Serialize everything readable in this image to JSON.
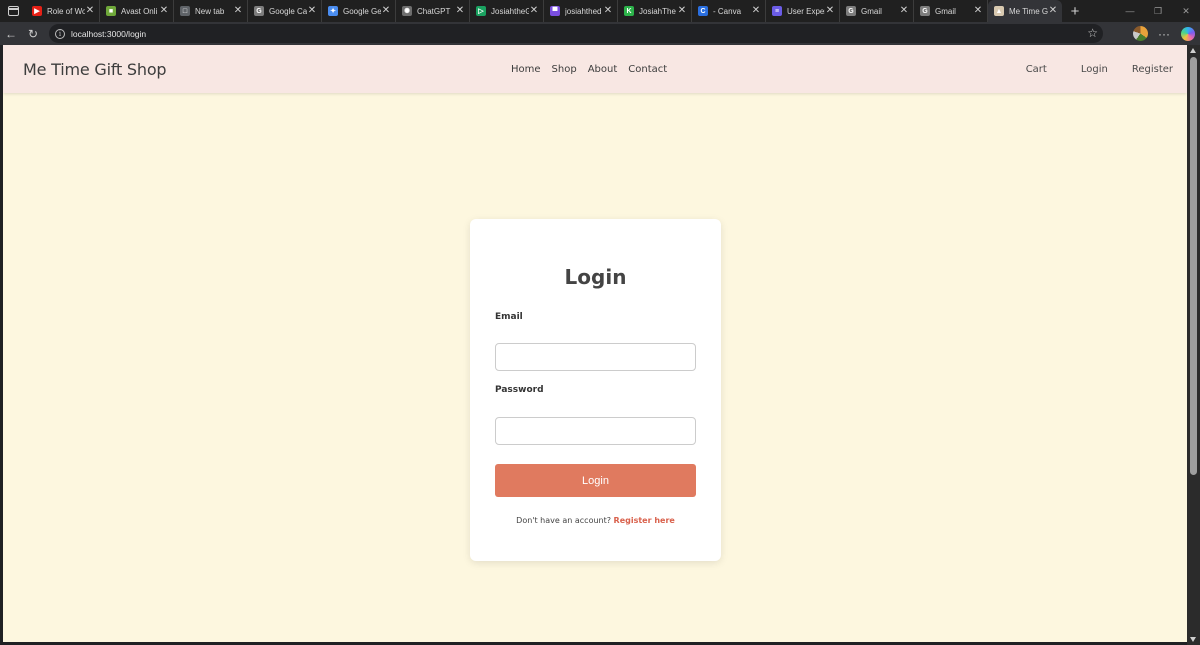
{
  "browser": {
    "tabs": [
      {
        "title": "Role of Wo",
        "fav_color": "#e62117",
        "fav_glyph": "▶",
        "active": false
      },
      {
        "title": "Avast Onli",
        "fav_color": "#6fa83a",
        "fav_glyph": "■",
        "active": false
      },
      {
        "title": "New tab",
        "fav_color": "#5f6368",
        "fav_glyph": "□",
        "active": false
      },
      {
        "title": "Google Ca",
        "fav_color": "#7d7d7d",
        "fav_glyph": "G",
        "active": false
      },
      {
        "title": "Google Ge",
        "fav_color": "#4a8df0",
        "fav_glyph": "✦",
        "active": false
      },
      {
        "title": "ChatGPT",
        "fav_color": "#6e6e6e",
        "fav_glyph": "✺",
        "active": false
      },
      {
        "title": "JosiahtheG",
        "fav_color": "#1aa260",
        "fav_glyph": "▷",
        "active": false
      },
      {
        "title": "josiahthed",
        "fav_color": "#7a4ee0",
        "fav_glyph": "▀",
        "active": false
      },
      {
        "title": "JosiahThe",
        "fav_color": "#2cb34a",
        "fav_glyph": "K",
        "active": false
      },
      {
        "title": "- Canva",
        "fav_color": "#2a6fe0",
        "fav_glyph": "C",
        "active": false
      },
      {
        "title": "User Exper",
        "fav_color": "#6b5ce6",
        "fav_glyph": "≡",
        "active": false
      },
      {
        "title": "Gmail",
        "fav_color": "#7d7d7d",
        "fav_glyph": "G",
        "active": false
      },
      {
        "title": "Gmail",
        "fav_color": "#7d7d7d",
        "fav_glyph": "G",
        "active": false
      },
      {
        "title": "Me Time G",
        "fav_color": "#d8c9b0",
        "fav_glyph": "▲",
        "active": true
      }
    ],
    "new_tab_glyph": "+",
    "window_controls": {
      "minimize": "—",
      "restore": "❐",
      "close": "✕"
    },
    "address": {
      "url": "localhost:3000/login"
    },
    "toolbar_glyphs": {
      "back": "←",
      "reload": "↻",
      "star": "☆",
      "more": "···",
      "info": "i"
    }
  },
  "site": {
    "brand": "Me Time Gift Shop",
    "main_nav": [
      "Home",
      "Shop",
      "About",
      "Contact"
    ],
    "user_nav": [
      "Cart",
      "Login",
      "Register"
    ],
    "login": {
      "title": "Login",
      "email_label": "Email",
      "email_value": "",
      "password_label": "Password",
      "password_value": "",
      "submit_label": "Login",
      "register_prompt": "Don't have an account?",
      "register_link": "Register here"
    },
    "colors": {
      "page_background": "#fdf7df",
      "header_background": "#f8e7e3",
      "accent": "#e07a5f",
      "link": "#d9614c"
    }
  }
}
